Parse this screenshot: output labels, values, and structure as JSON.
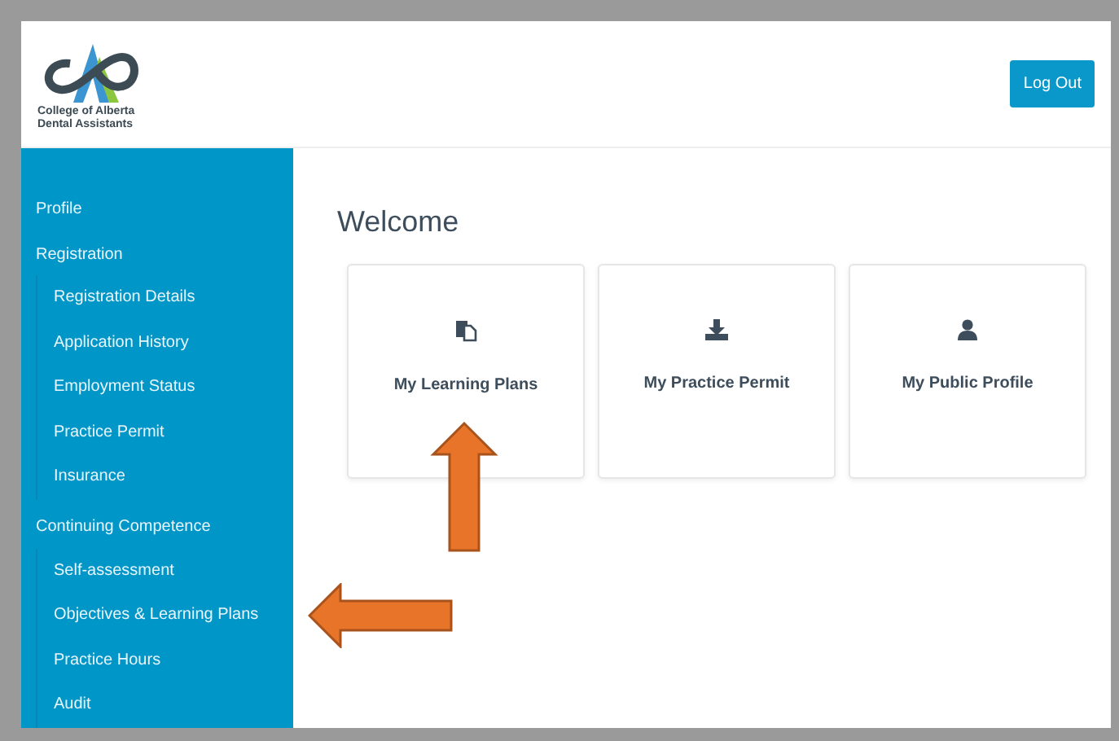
{
  "header": {
    "logo_text": [
      "College of Alberta",
      "Dental Assistants"
    ],
    "logout_button": "Log Out"
  },
  "sidebar": {
    "items": [
      {
        "label": "Profile"
      },
      {
        "label": "Registration",
        "children": [
          {
            "label": "Registration Details"
          },
          {
            "label": "Application History"
          },
          {
            "label": "Employment Status"
          },
          {
            "label": "Practice Permit"
          },
          {
            "label": "Insurance"
          }
        ]
      },
      {
        "label": "Continuing Competence",
        "children": [
          {
            "label": "Self-assessment"
          },
          {
            "label": "Objectives & Learning Plans"
          },
          {
            "label": "Practice Hours"
          },
          {
            "label": "Audit"
          }
        ]
      }
    ]
  },
  "main": {
    "title": "Welcome",
    "cards": [
      {
        "kind": "documents",
        "label": "My Learning Plans"
      },
      {
        "kind": "download",
        "label": "My Practice Permit"
      },
      {
        "kind": "person",
        "label": "My Public Profile"
      }
    ]
  }
}
